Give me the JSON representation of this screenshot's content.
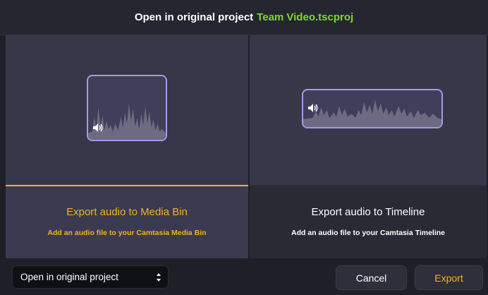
{
  "header": {
    "prefix": "Open in original project",
    "project_name": "Team Video.tscproj"
  },
  "options": [
    {
      "title": "Export audio to Media Bin",
      "subtitle": "Add an audio file to your Camtasia Media Bin",
      "selected": true
    },
    {
      "title": "Export audio to Timeline",
      "subtitle": "Add an audio file to your Camtasia Timeline",
      "selected": false
    }
  ],
  "footer": {
    "select_value": "Open in original project",
    "cancel_label": "Cancel",
    "export_label": "Export"
  },
  "colors": {
    "accent": "#f2b21f",
    "project_name": "#7dd82e",
    "clip_border": "#a698e8"
  },
  "icons": [
    "speaker-icon",
    "select-arrows-icon",
    "audio-waveform"
  ]
}
